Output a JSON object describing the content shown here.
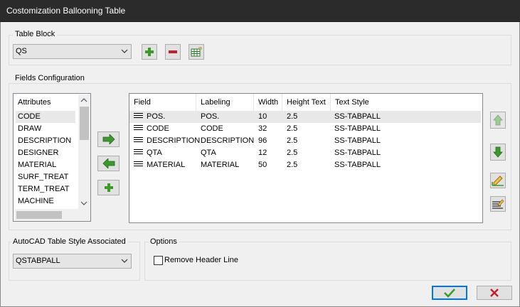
{
  "window": {
    "title": "Costomization Ballooning Table"
  },
  "table_block": {
    "label": "Table Block",
    "selected": "QS"
  },
  "fields_configuration": {
    "label": "Fields Configuration",
    "attributes_header": "Attributes",
    "attributes": [
      "CODE",
      "DRAW",
      "DESCRIPTION",
      "DESIGNER",
      "MATERIAL",
      "SURF_TREAT",
      "TERM_TREAT",
      "MACHINE"
    ],
    "columns": [
      "Field",
      "Labeling",
      "Width",
      "Height Text",
      "Text Style"
    ],
    "rows": [
      {
        "field": "POS.",
        "labeling": "POS.",
        "width": "10",
        "height": "2.5",
        "style": "SS-TABPALL"
      },
      {
        "field": "CODE",
        "labeling": "CODE",
        "width": "32",
        "height": "2.5",
        "style": "SS-TABPALL"
      },
      {
        "field": "DESCRIPTION",
        "labeling": "DESCRIPTION",
        "width": "96",
        "height": "2.5",
        "style": "SS-TABPALL"
      },
      {
        "field": "QTA",
        "labeling": "QTA",
        "width": "12",
        "height": "2.5",
        "style": "SS-TABPALL"
      },
      {
        "field": "MATERIAL",
        "labeling": "MATERIAL",
        "width": "50",
        "height": "2.5",
        "style": "SS-TABPALL"
      }
    ]
  },
  "autocad_style": {
    "label": "AutoCAD Table Style Associated",
    "selected": "QSTABPALL"
  },
  "options": {
    "label": "Options",
    "remove_header_label": "Remove Header Line",
    "remove_header_checked": false
  },
  "colors": {
    "add": "#3a9a2a",
    "remove": "#c0202a",
    "ok": "#3a9a2a",
    "cancel": "#c0202a",
    "focus": "#0078d7"
  }
}
